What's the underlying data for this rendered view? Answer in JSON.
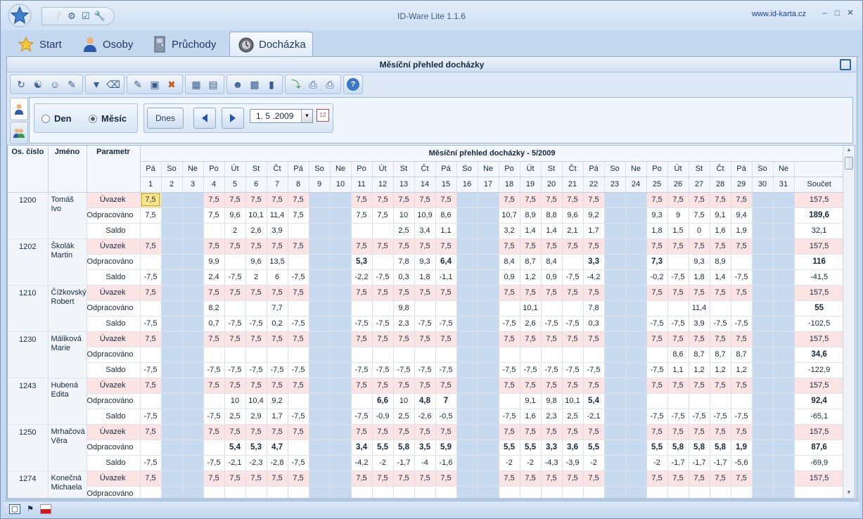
{
  "app": {
    "title": "ID-Ware Lite 1.1.6",
    "url": "www.id-karta.cz"
  },
  "tabs": [
    {
      "label": "Start",
      "icon": "star-icon"
    },
    {
      "label": "Osoby",
      "icon": "person-icon"
    },
    {
      "label": "Průchody",
      "icon": "door-icon"
    },
    {
      "label": "Docházka",
      "icon": "clock-icon",
      "active": true
    }
  ],
  "panel": {
    "title": "Měsíční přehled docházky"
  },
  "filter": {
    "radio_day": "Den",
    "radio_month": "Měsíc",
    "selected": "Měsíc",
    "today_button": "Dnes",
    "date_value": "1. 5 .2009"
  },
  "grid": {
    "col_person": "Os. číslo",
    "col_name": "Jméno",
    "col_param": "Parametr",
    "header_title": "Měsíční přehled docházky - 5/2009",
    "col_sum": "Součet",
    "day_names": [
      "Pá",
      "So",
      "Ne",
      "Po",
      "Út",
      "St",
      "Čt",
      "Pá",
      "So",
      "Ne",
      "Po",
      "Út",
      "St",
      "Čt",
      "Pá",
      "So",
      "Ne",
      "Po",
      "Út",
      "St",
      "Čt",
      "Pá",
      "So",
      "Ne",
      "Po",
      "Út",
      "St",
      "Čt",
      "Pá",
      "So",
      "Ne"
    ],
    "day_numbers": [
      "1",
      "2",
      "3",
      "4",
      "5",
      "6",
      "7",
      "8",
      "9",
      "10",
      "11",
      "12",
      "13",
      "14",
      "15",
      "16",
      "17",
      "18",
      "19",
      "20",
      "21",
      "22",
      "23",
      "24",
      "25",
      "26",
      "27",
      "28",
      "29",
      "30",
      "31"
    ],
    "weekend_days": [
      2,
      3,
      9,
      10,
      16,
      17,
      23,
      24,
      30,
      31
    ],
    "params": {
      "uvazek": "Úvazek",
      "odpracovano": "Odpracováno",
      "saldo": "Saldo"
    },
    "persons": [
      {
        "id": "1200",
        "name": "Tomáš Ivo",
        "uvazek": [
          "7,5",
          "",
          "",
          "7,5",
          "7,5",
          "7,5",
          "7,5",
          "7,5",
          "",
          "",
          "7,5",
          "7,5",
          "7,5",
          "7,5",
          "7,5",
          "",
          "",
          "7,5",
          "7,5",
          "7,5",
          "7,5",
          "7,5",
          "",
          "",
          "7,5",
          "7,5",
          "7,5",
          "7,5",
          "7,5",
          "",
          ""
        ],
        "uvazek_sum": "157,5",
        "odpr": [
          "7,5",
          "",
          "",
          "7,5",
          "9,6",
          "10,1",
          "11,4",
          "7,5",
          "",
          "",
          "7,5",
          "7,5",
          "10",
          "10,9",
          "8,6",
          "",
          "",
          "10,7",
          "8,9",
          "8,8",
          "9,6",
          "9,2",
          "",
          "",
          "9,3",
          "9",
          "7,5",
          "9,1",
          "9,4",
          "",
          ""
        ],
        "odpr_sum": "189,6",
        "odpr_bold": [],
        "saldo": [
          "",
          "",
          "",
          "",
          "2",
          "2,6",
          "3,9",
          "",
          "",
          "",
          "",
          "",
          "2,5",
          "3,4",
          "1,1",
          "",
          "",
          "3,2",
          "1,4",
          "1,4",
          "2,1",
          "1,7",
          "",
          "",
          "1,8",
          "1,5",
          "0",
          "1,6",
          "1,9",
          "",
          ""
        ],
        "saldo_sum": "32,1"
      },
      {
        "id": "1202",
        "name": "Školák Martin",
        "uvazek": [
          "7,5",
          "",
          "",
          "7,5",
          "7,5",
          "7,5",
          "7,5",
          "7,5",
          "",
          "",
          "7,5",
          "7,5",
          "7,5",
          "7,5",
          "7,5",
          "",
          "",
          "7,5",
          "7,5",
          "7,5",
          "7,5",
          "7,5",
          "",
          "",
          "7,5",
          "7,5",
          "7,5",
          "7,5",
          "7,5",
          "",
          ""
        ],
        "uvazek_sum": "157,5",
        "odpr": [
          "",
          "",
          "",
          "9,9",
          "",
          "9,6",
          "13,5",
          "",
          "",
          "",
          "5,3",
          "",
          "7,8",
          "9,3",
          "6,4",
          "",
          "",
          "8,4",
          "8,7",
          "8,4",
          "",
          "3,3",
          "",
          "",
          "7,3",
          "",
          "9,3",
          "8,9",
          "",
          "",
          ""
        ],
        "odpr_sum": "116",
        "odpr_bold": [
          11,
          15,
          22,
          25
        ],
        "saldo": [
          "-7,5",
          "",
          "",
          "2,4",
          "-7,5",
          "2",
          "6",
          "-7,5",
          "",
          "",
          "-2,2",
          "-7,5",
          "0,3",
          "1,8",
          "-1,1",
          "",
          "",
          "0,9",
          "1,2",
          "0,9",
          "-7,5",
          "-4,2",
          "",
          "",
          "-0,2",
          "-7,5",
          "1,8",
          "1,4",
          "-7,5",
          "",
          ""
        ],
        "saldo_sum": "-41,5"
      },
      {
        "id": "1210",
        "name": "Čížkovský Robert",
        "uvazek": [
          "7,5",
          "",
          "",
          "7,5",
          "7,5",
          "7,5",
          "7,5",
          "7,5",
          "",
          "",
          "7,5",
          "7,5",
          "7,5",
          "7,5",
          "7,5",
          "",
          "",
          "7,5",
          "7,5",
          "7,5",
          "7,5",
          "7,5",
          "",
          "",
          "7,5",
          "7,5",
          "7,5",
          "7,5",
          "7,5",
          "",
          ""
        ],
        "uvazek_sum": "157,5",
        "odpr": [
          "",
          "",
          "",
          "8,2",
          "",
          "",
          "7,7",
          "",
          "",
          "",
          "",
          "",
          "9,8",
          "",
          "",
          "",
          "",
          "",
          "10,1",
          "",
          "",
          "7,8",
          "",
          "",
          "",
          "",
          "11,4",
          "",
          "",
          "",
          ""
        ],
        "odpr_sum": "55",
        "odpr_bold": [],
        "saldo": [
          "-7,5",
          "",
          "",
          "0,7",
          "-7,5",
          "-7,5",
          "0,2",
          "-7,5",
          "",
          "",
          "-7,5",
          "-7,5",
          "2,3",
          "-7,5",
          "-7,5",
          "",
          "",
          "-7,5",
          "2,6",
          "-7,5",
          "-7,5",
          "0,3",
          "",
          "",
          "-7,5",
          "-7,5",
          "3,9",
          "-7,5",
          "-7,5",
          "",
          ""
        ],
        "saldo_sum": "-102,5"
      },
      {
        "id": "1230",
        "name": "Máliková Marie",
        "uvazek": [
          "7,5",
          "",
          "",
          "7,5",
          "7,5",
          "7,5",
          "7,5",
          "7,5",
          "",
          "",
          "7,5",
          "7,5",
          "7,5",
          "7,5",
          "7,5",
          "",
          "",
          "7,5",
          "7,5",
          "7,5",
          "7,5",
          "7,5",
          "",
          "",
          "7,5",
          "7,5",
          "7,5",
          "7,5",
          "7,5",
          "",
          ""
        ],
        "uvazek_sum": "157,5",
        "odpr": [
          "",
          "",
          "",
          "",
          "",
          "",
          "",
          "",
          "",
          "",
          "",
          "",
          "",
          "",
          "",
          "",
          "",
          "",
          "",
          "",
          "",
          "",
          "",
          "",
          "",
          "8,6",
          "8,7",
          "8,7",
          "8,7",
          "",
          ""
        ],
        "odpr_sum": "34,6",
        "odpr_bold": [],
        "saldo": [
          "-7,5",
          "",
          "",
          "-7,5",
          "-7,5",
          "-7,5",
          "-7,5",
          "-7,5",
          "",
          "",
          "-7,5",
          "-7,5",
          "-7,5",
          "-7,5",
          "-7,5",
          "",
          "",
          "-7,5",
          "-7,5",
          "-7,5",
          "-7,5",
          "-7,5",
          "",
          "",
          "-7,5",
          "1,1",
          "1,2",
          "1,2",
          "1,2",
          "",
          ""
        ],
        "saldo_sum": "-122,9"
      },
      {
        "id": "1243",
        "name": "Hubená Edita",
        "uvazek": [
          "7,5",
          "",
          "",
          "7,5",
          "7,5",
          "7,5",
          "7,5",
          "7,5",
          "",
          "",
          "7,5",
          "7,5",
          "7,5",
          "7,5",
          "7,5",
          "",
          "",
          "7,5",
          "7,5",
          "7,5",
          "7,5",
          "7,5",
          "",
          "",
          "7,5",
          "7,5",
          "7,5",
          "7,5",
          "7,5",
          "",
          ""
        ],
        "uvazek_sum": "157,5",
        "odpr": [
          "",
          "",
          "",
          "",
          "10",
          "10,4",
          "9,2",
          "",
          "",
          "",
          "",
          "6,6",
          "10",
          "4,8",
          "7",
          "",
          "",
          "",
          "9,1",
          "9,8",
          "10,1",
          "5,4",
          "",
          "",
          "",
          "",
          "",
          "",
          "",
          "",
          ""
        ],
        "odpr_sum": "92,4",
        "odpr_bold": [
          12,
          14,
          15,
          22
        ],
        "saldo": [
          "-7,5",
          "",
          "",
          "-7,5",
          "2,5",
          "2,9",
          "1,7",
          "-7,5",
          "",
          "",
          "-7,5",
          "-0,9",
          "2,5",
          "-2,6",
          "-0,5",
          "",
          "",
          "-7,5",
          "1,6",
          "2,3",
          "2,5",
          "-2,1",
          "",
          "",
          "-7,5",
          "-7,5",
          "-7,5",
          "-7,5",
          "-7,5",
          "",
          ""
        ],
        "saldo_sum": "-65,1"
      },
      {
        "id": "1250",
        "name": "Mrhačová Věra",
        "uvazek": [
          "7,5",
          "",
          "",
          "7,5",
          "7,5",
          "7,5",
          "7,5",
          "7,5",
          "",
          "",
          "7,5",
          "7,5",
          "7,5",
          "7,5",
          "7,5",
          "",
          "",
          "7,5",
          "7,5",
          "7,5",
          "7,5",
          "7,5",
          "",
          "",
          "7,5",
          "7,5",
          "7,5",
          "7,5",
          "7,5",
          "",
          ""
        ],
        "uvazek_sum": "157,5",
        "odpr": [
          "",
          "",
          "",
          "",
          "5,4",
          "5,3",
          "4,7",
          "",
          "",
          "",
          "3,4",
          "5,5",
          "5,8",
          "3,5",
          "5,9",
          "",
          "",
          "5,5",
          "5,5",
          "3,3",
          "3,6",
          "5,5",
          "",
          "",
          "5,5",
          "5,8",
          "5,8",
          "5,8",
          "1,9",
          "",
          ""
        ],
        "odpr_sum": "87,6",
        "odpr_bold": [
          5,
          6,
          7,
          11,
          12,
          13,
          14,
          15,
          18,
          19,
          20,
          21,
          22,
          25,
          26,
          27,
          28,
          29
        ],
        "saldo": [
          "-7,5",
          "",
          "",
          "-7,5",
          "-2,1",
          "-2,3",
          "-2,8",
          "-7,5",
          "",
          "",
          "-4,2",
          "-2",
          "-1,7",
          "-4",
          "-1,6",
          "",
          "",
          "-2",
          "-2",
          "-4,3",
          "-3,9",
          "-2",
          "",
          "",
          "-2",
          "-1,7",
          "-1,7",
          "-1,7",
          "-5,6",
          "",
          ""
        ],
        "saldo_sum": "-69,9"
      },
      {
        "id": "1274",
        "name": "Konečná Michaela",
        "uvazek": [
          "7,5",
          "",
          "",
          "7,5",
          "7,5",
          "7,5",
          "7,5",
          "7,5",
          "",
          "",
          "7,5",
          "7,5",
          "7,5",
          "7,5",
          "7,5",
          "",
          "",
          "7,5",
          "7,5",
          "7,5",
          "7,5",
          "7,5",
          "",
          "",
          "7,5",
          "7,5",
          "7,5",
          "7,5",
          "7,5",
          "",
          ""
        ],
        "uvazek_sum": "157,5",
        "odpr": [
          "",
          "",
          "",
          "",
          "",
          "",
          "",
          "",
          "",
          "",
          "",
          "",
          "",
          "",
          "",
          "",
          "",
          "",
          "",
          "",
          "",
          "",
          "",
          "",
          "",
          "",
          "",
          "",
          "",
          "",
          ""
        ],
        "odpr_sum": "",
        "odpr_bold": [],
        "saldo": null,
        "saldo_sum": ""
      }
    ]
  },
  "colors": {
    "uvazek_row": "#fde4e4",
    "weekend": "#c7daf0",
    "highlight": "#fde58a"
  }
}
